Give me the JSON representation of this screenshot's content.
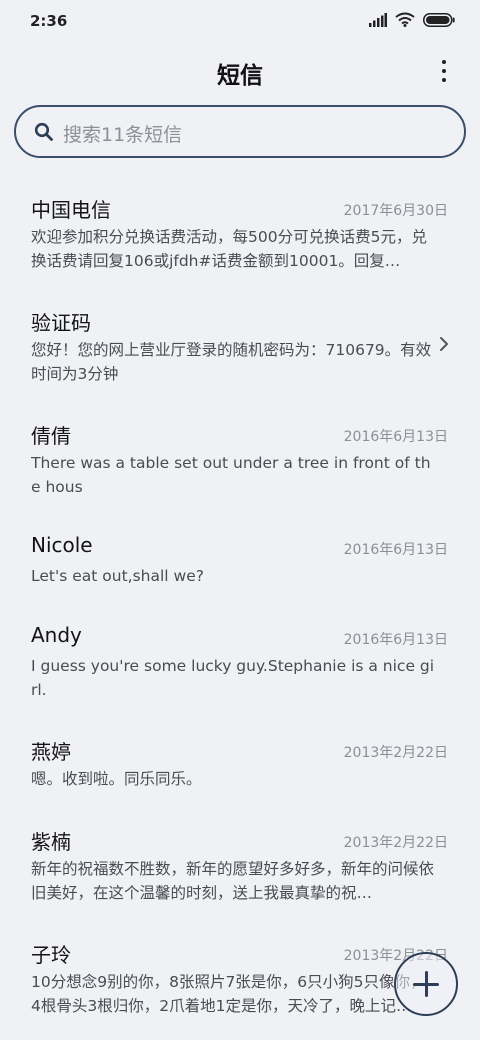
{
  "status_bar": {
    "time": "2:36",
    "icons": [
      "signal-icon",
      "wifi-icon",
      "battery-icon"
    ]
  },
  "header": {
    "title": "短信",
    "more_icon": "more-vertical-icon"
  },
  "search": {
    "placeholder": "搜索11条短信",
    "icon": "search-icon"
  },
  "messages": [
    {
      "sender": "中国电信",
      "date": "2017年6月30日",
      "preview": "欢迎参加积分兑换话费活动，每500分可兑换话费5元，兑换话费请回复106或jfdh#话费金额到10001。回复…"
    },
    {
      "sender": "验证码",
      "date": "",
      "preview": "您好！您的网上营业厅登录的随机密码为：710679。有效时间为3分钟"
    },
    {
      "sender": "倩倩",
      "date": "2016年6月13日",
      "preview": "There was a table set out under a tree in front of the hous"
    },
    {
      "sender": "Nicole",
      "date": "2016年6月13日",
      "preview": "Let's eat out,shall we?"
    },
    {
      "sender": "Andy",
      "date": "2016年6月13日",
      "preview": "I guess you're some lucky guy.Stephanie is a nice girl."
    },
    {
      "sender": "燕婷",
      "date": "2013年2月22日",
      "preview": "嗯。收到啦。同乐同乐。"
    },
    {
      "sender": "紫楠",
      "date": "2013年2月22日",
      "preview": "新年的祝福数不胜数，新年的愿望好多好多，新年的问候依旧美好，在这个温馨的时刻，送上我最真挚的祝…"
    },
    {
      "sender": "子玲",
      "date": "2013年2月22日",
      "preview": "10分想念9别的你，8张照片7张是你，6只小狗5只像你，4根骨头3根归你，2爪着地1定是你，天冷了，晚上记…"
    }
  ],
  "compose": {
    "icon": "plus-icon"
  },
  "colors": {
    "background": "#eff1f5",
    "accent": "#2e3e57",
    "date_text": "#8c8f96"
  }
}
